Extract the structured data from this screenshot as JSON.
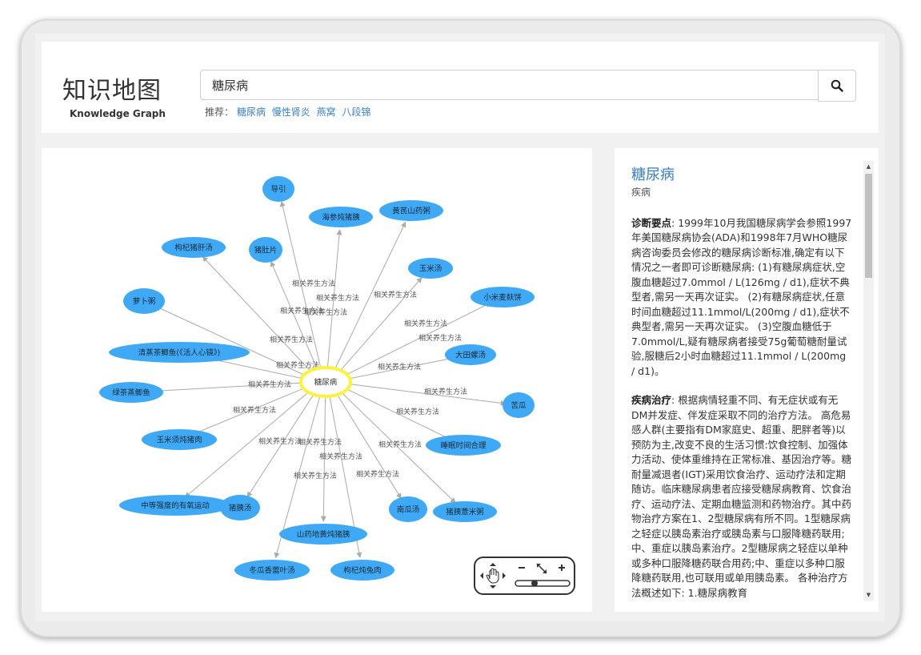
{
  "header": {
    "title": "知识地图",
    "subtitle": "Knowledge Graph",
    "search_value": "糖尿病",
    "recommend_label": "推荐：",
    "recommend_items": [
      "糖尿病",
      "慢性肾炎",
      "燕窝",
      "八段锦"
    ]
  },
  "graph": {
    "center": "糖尿病",
    "edge_label": "相关养生方法",
    "nodes": [
      "导引",
      "海参炖猪胰",
      "黄芪山药粥",
      "枸杞猪肝汤",
      "猪肚片",
      "玉米汤",
      "萝卜粥",
      "小米麦麸饼",
      "大田螺汤",
      "清蒸茶鲫鱼(《活人心镜》)",
      "绿茶蒸鲫鱼",
      "苦瓜",
      "玉米须炖猪肉",
      "睡眠时间合理",
      "中等强度的有氧运动",
      "猪胰汤",
      "南瓜汤",
      "猪胰薏米粥",
      "山药地黄炖猪胰",
      "冬瓜香薷叶汤",
      "枸杞炖兔肉"
    ]
  },
  "info": {
    "title": "糖尿病",
    "type": "疾病",
    "sections": [
      {
        "heading": "诊断要点",
        "text": ": 1999年10月我国糖尿病学会参照1997年美国糖尿病协会(ADA)和1998年7月WHO糖尿病咨询委员会修改的糖尿病诊断标准,确定有以下情况之一者即可诊断糖尿病: (1)有糖尿病症状,空腹血糖超过7.0mmol / L(126mg / d1),症状不典型者,需另一天再次证实。 (2)有糖尿病症状,任意时间血糖超过11.1mmol/L(200mg / d1),症状不典型者,需另一天再次证实。 (3)空腹血糖低于7.0mmol/L,疑有糖尿病者接受75g葡萄糖耐量试验,服糖后2小时血糖超过11.1mmol / L(200mg / d1)。"
      },
      {
        "heading": "疾病治疗",
        "text": ": 根据病情轻重不同、有无症状或有无DM并发症、伴发症采取不同的治疗方法。 高危易感人群(主要指有DM家庭史、超重、肥胖者等)以预防为主,改变不良的生活习惯:饮食控制、加强体力活动、使体重维持在正常标准、基因治疗等。糖耐量减退者(IGT)采用饮食治疗、运动疗法和定期随访。临床糖尿病患者应接受糖尿病教育、饮食治疗、运动疗法、定期血糖监测和药物治疗。其中药物治疗方案在1、2型糖尿病有所不同。1型糖尿病之轻症以胰岛素治疗或胰岛素与口服降糖药联用;中、重症以胰岛素治疗。2型糖尿病之轻症以单种或多种口服降糖药联合用药;中、重症以多种口服降糖药联用,也可联用或单用胰岛素。 各种治疗方法概述如下: 1.糖尿病教育"
      }
    ]
  },
  "colors": {
    "node": "#3fa9f5",
    "center_fill": "#ffffff",
    "center_stroke": "#fff23c",
    "link": "#3a7fc1",
    "edge": "#aaaaaa"
  },
  "icons": [
    "search-icon",
    "pan-icon",
    "zoom-out-icon",
    "fit-icon",
    "zoom-in-icon"
  ]
}
